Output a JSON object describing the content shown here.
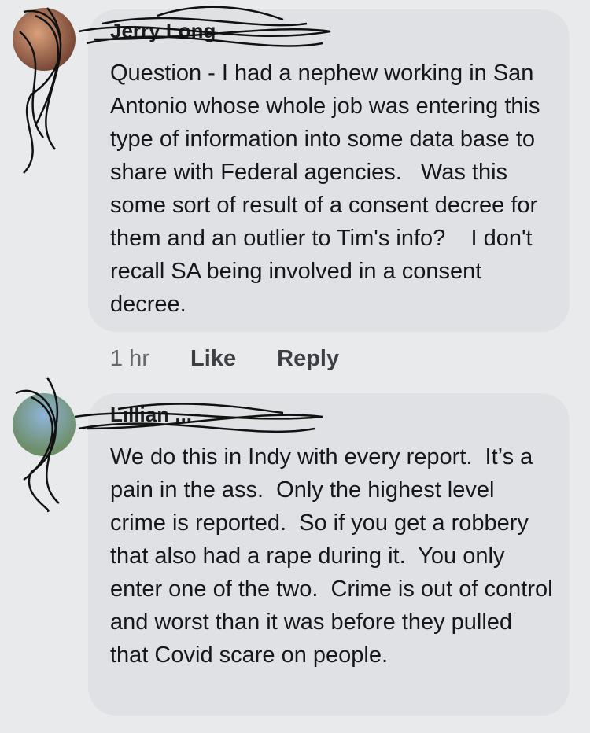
{
  "comments": [
    {
      "author": "Jerry Long",
      "text": "Question - I had a nephew working in San Antonio whose whole job was entering this type of information into some data base to share with Federal agencies.   Was this some sort of result of a consent decree for them and an outlier to Tim's info?    I don't recall SA being involved in a consent decree.",
      "time": "1 hr",
      "like": "Like",
      "reply": "Reply"
    },
    {
      "author": "Lillian ...",
      "text": "We do this in Indy with every report.  It’s a pain in the ass.  Only the highest level crime is reported.  So if you get a robbery that also had a rape during it.  You only enter one of the two.  Crime is out of control and worst than it was before they pulled that Covid scare on people."
    }
  ]
}
